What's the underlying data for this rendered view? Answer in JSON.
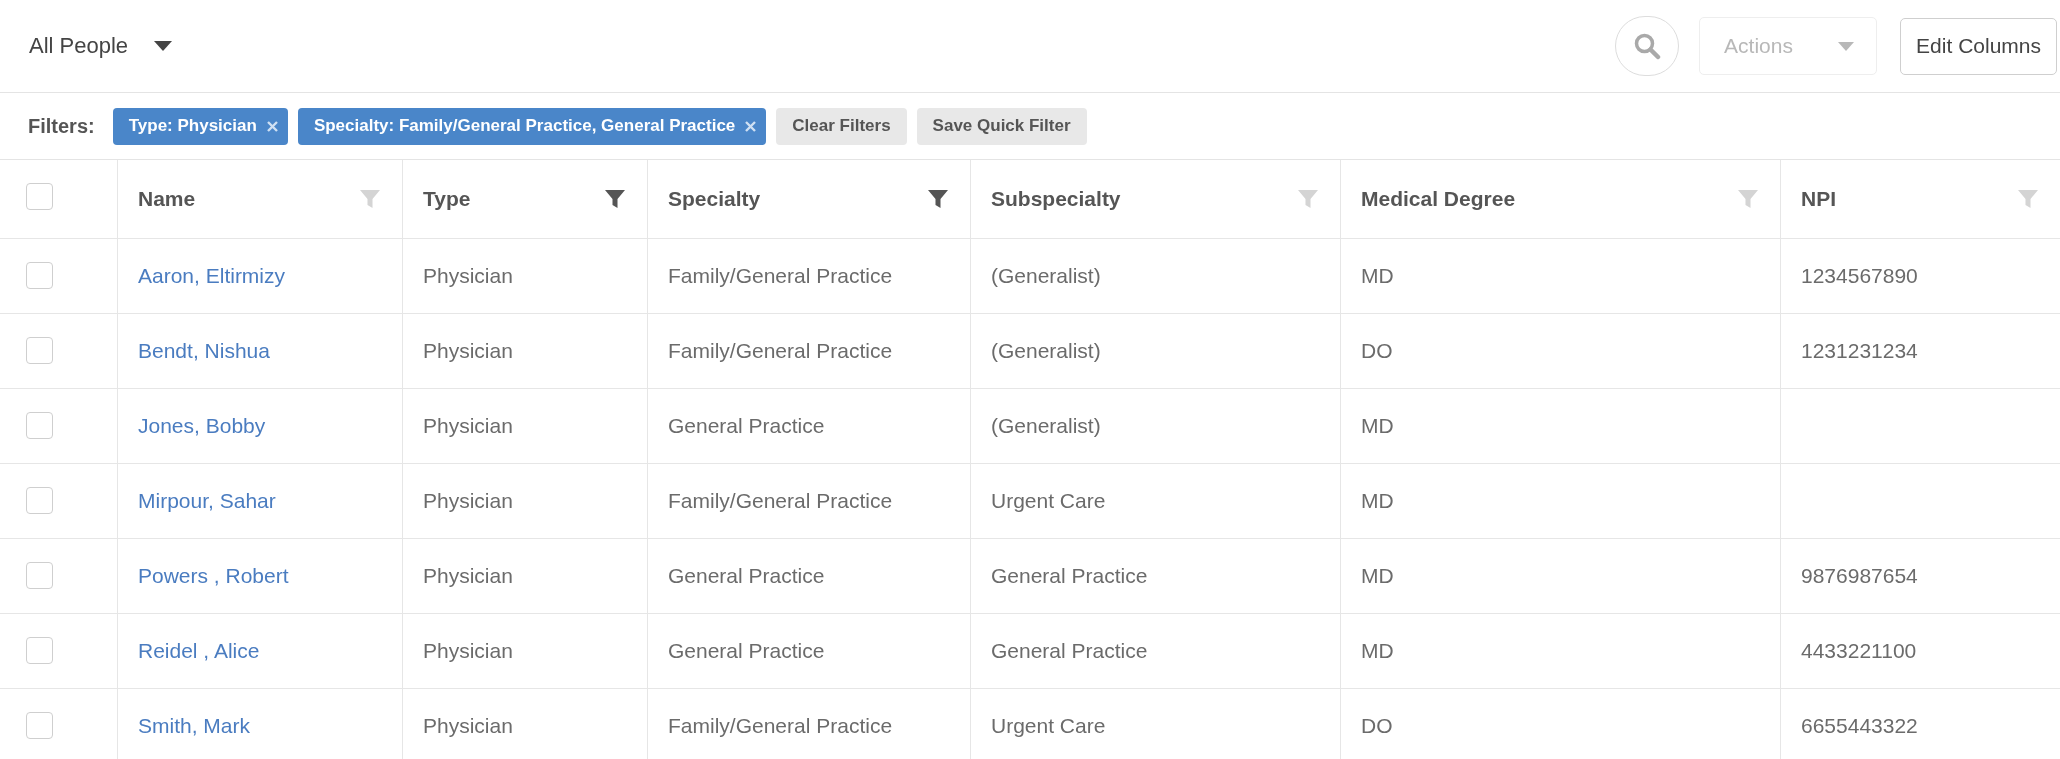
{
  "view_selector": {
    "label": "All People"
  },
  "actions_button": {
    "label": "Actions",
    "disabled": true
  },
  "edit_columns_button": {
    "label": "Edit Columns"
  },
  "filters": {
    "label": "Filters:",
    "chips": [
      {
        "label": "Type: Physician"
      },
      {
        "label": "Specialty: Family/General Practice, General Practice"
      }
    ],
    "buttons": [
      "Clear Filters",
      "Save Quick Filter"
    ]
  },
  "table": {
    "select_all": {
      "checked": false
    },
    "columns": [
      {
        "label": "Name",
        "filter_active": false
      },
      {
        "label": "Type",
        "filter_active": true
      },
      {
        "label": "Specialty",
        "filter_active": true
      },
      {
        "label": "Subspecialty",
        "filter_active": false
      },
      {
        "label": "Medical Degree",
        "filter_active": false
      },
      {
        "label": "NPI",
        "filter_active": false
      }
    ],
    "rows": [
      {
        "checked": false,
        "name": "Aaron, Eltirmizy",
        "type": "Physician",
        "specialty": "Family/General Practice",
        "subspecialty": "(Generalist)",
        "medical_degree": "MD",
        "npi": "1234567890"
      },
      {
        "checked": false,
        "name": "Bendt, Nishua",
        "type": "Physician",
        "specialty": "Family/General Practice",
        "subspecialty": "(Generalist)",
        "medical_degree": "DO",
        "npi": "1231231234"
      },
      {
        "checked": false,
        "name": "Jones, Bobby",
        "type": "Physician",
        "specialty": "General Practice",
        "subspecialty": "(Generalist)",
        "medical_degree": "MD"
      },
      {
        "checked": false,
        "name": "Mirpour, Sahar",
        "type": "Physician",
        "specialty": "Family/General Practice",
        "subspecialty": "Urgent Care",
        "medical_degree": "MD"
      },
      {
        "checked": false,
        "name": "Powers , Robert",
        "type": "Physician",
        "specialty": "General Practice",
        "subspecialty": "General Practice",
        "medical_degree": "MD",
        "npi": "9876987654"
      },
      {
        "checked": false,
        "name": "Reidel , Alice",
        "type": "Physician",
        "specialty": "General Practice",
        "subspecialty": "General Practice",
        "medical_degree": "MD",
        "npi": "4433221100"
      },
      {
        "checked": false,
        "name": "Smith, Mark",
        "type": "Physician",
        "specialty": "Family/General Practice",
        "subspecialty": "Urgent Care",
        "medical_degree": "DO",
        "npi": "6655443322"
      }
    ]
  }
}
